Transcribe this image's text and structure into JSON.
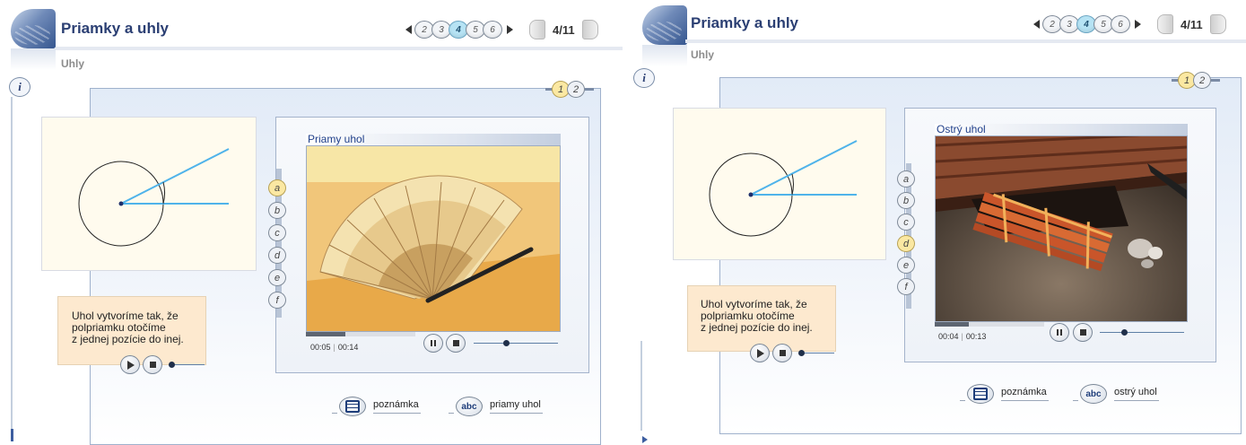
{
  "panels": [
    {
      "title": "Priamky a uhly",
      "subtitle": "Uhly",
      "info_label": "i",
      "page_nav": {
        "pages": [
          "2",
          "3",
          "4",
          "5",
          "6"
        ],
        "active_index": 2,
        "counter": "4/11"
      },
      "steps": {
        "items": [
          "1",
          "2"
        ],
        "active_index": 0
      },
      "diagram": {
        "angle_degrees": 27
      },
      "video": {
        "title": "Priamy uhol",
        "time_current": "00:05",
        "time_total": "00:14",
        "progress": 0.36,
        "volume": 0.4,
        "scene": "hand-fan"
      },
      "side_buttons": {
        "items": [
          "a",
          "b",
          "c",
          "d",
          "e",
          "f"
        ],
        "active_index": 0
      },
      "caption": {
        "lines": [
          "Uhol vytvoríme tak, že",
          "polpriamku otočíme",
          "z jednej pozície do inej."
        ]
      },
      "tools": {
        "note_label": "poznámka",
        "term_label": "priamy uhol"
      }
    },
    {
      "title": "Priamky a uhly",
      "subtitle": "Uhly",
      "info_label": "i",
      "page_nav": {
        "pages": [
          "2",
          "3",
          "4",
          "5",
          "6"
        ],
        "active_index": 2,
        "counter": "4/11"
      },
      "steps": {
        "items": [
          "1",
          "2"
        ],
        "active_index": 0
      },
      "diagram": {
        "angle_degrees": 27
      },
      "video": {
        "title": "Ostrý uhol",
        "time_current": "00:04",
        "time_total": "00:13",
        "progress": 0.31,
        "volume": 0.3,
        "scene": "opening-hatch"
      },
      "side_buttons": {
        "items": [
          "a",
          "b",
          "c",
          "d",
          "e",
          "f"
        ],
        "active_index": 3
      },
      "caption": {
        "lines": [
          "Uhol vytvoríme tak, že",
          "polpriamku otočíme",
          "z jednej pozície do inej."
        ]
      },
      "tools": {
        "note_label": "poznámka",
        "term_label": "ostrý uhol"
      }
    }
  ],
  "colors": {
    "title": "#2b3f73",
    "active_page": "#b6e3f4",
    "active_step": "#fbe8a2",
    "caption_bg": "#fde9cf",
    "ray": "#4fb3ea"
  }
}
